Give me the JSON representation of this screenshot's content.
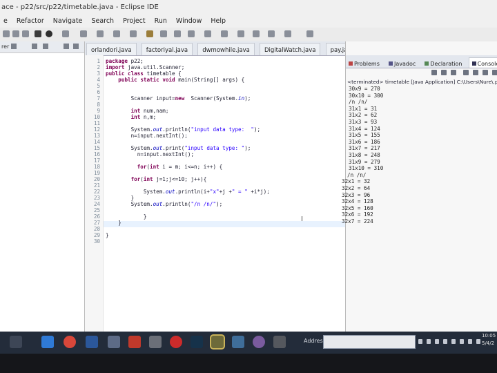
{
  "window": {
    "title": "ace - p22/src/p22/timetable.java - Eclipse IDE"
  },
  "menu": [
    "e",
    "Refactor",
    "Navigate",
    "Search",
    "Project",
    "Run",
    "Window",
    "Help"
  ],
  "left_panel": {
    "header": "rer"
  },
  "editor": {
    "tabs": [
      {
        "label": "orlandori.java",
        "active": false
      },
      {
        "label": "factoriyal.java",
        "active": false
      },
      {
        "label": "dwmowhile.java",
        "active": false
      },
      {
        "label": "DigitalWatch.java",
        "active": false
      },
      {
        "label": "pay.jav",
        "active": false
      }
    ],
    "line_numbers": [
      "1",
      "2",
      "3",
      "4",
      "5",
      "6",
      "7",
      "8",
      "9",
      "10",
      "11",
      "12",
      "13",
      "14",
      "15",
      "16",
      "17",
      "18",
      "19",
      "20",
      "21",
      "22",
      "23",
      "24",
      "25",
      "26",
      "27",
      "28",
      "29",
      "30"
    ],
    "code_lines": [
      "package p22;",
      "import java.util.Scanner;",
      "public class timetable {",
      "    public static void main(String[] args) {",
      "",
      "",
      "        Scanner input=new  Scanner(System.in);",
      "",
      "        int num,nam;",
      "        int n,m;",
      "",
      "        System.out.println(\"input data type:  \");",
      "        n=input.nextInt();",
      "",
      "        System.out.print(\"input data type: \");",
      "          n=input.nextInt();",
      "",
      "          for(int i = m; i<=n; i++) {",
      "",
      "        for(int j=1;j<=10; j++){",
      "",
      "            System.out.println(i+\"x\"+j +\" = \" +i*j);",
      "        }",
      "        System.out.println(\"/n /n/\");",
      "",
      "            }",
      "    }",
      "",
      "}",
      ""
    ]
  },
  "right_panel": {
    "tabs": [
      {
        "label": "Problems",
        "active": false
      },
      {
        "label": "Javadoc",
        "active": false
      },
      {
        "label": "Declaration",
        "active": false
      },
      {
        "label": "Console",
        "active": true
      }
    ],
    "console_header": "<terminated> timetable [Java Application] C:\\Users\\Nure\\.p2\\pool\\pl",
    "console_lines": [
      "30x9 = 270",
      "30x10 = 300",
      "/n /n/",
      "31x1 = 31",
      "31x2 = 62",
      "31x3 = 93",
      "31x4 = 124",
      "31x5 = 155",
      "31x6 = 186",
      "31x7 = 217",
      "31x8 = 248",
      "31x9 = 279",
      "31x10 = 310",
      "/n /n/",
      "32x1 = 32",
      "32x2 = 64",
      "32x3 = 96",
      "32x4 = 128",
      "32x5 = 160",
      "32x6 = 192",
      "32x7 = 224"
    ]
  },
  "taskbar": {
    "address_label": "Address",
    "clock_time": "10:05",
    "clock_date": "5/4/2"
  },
  "colors": {
    "keyword": "#7f0055",
    "string": "#2a00ff",
    "static_field": "#0000c0",
    "taskbar": "#232c3a"
  }
}
